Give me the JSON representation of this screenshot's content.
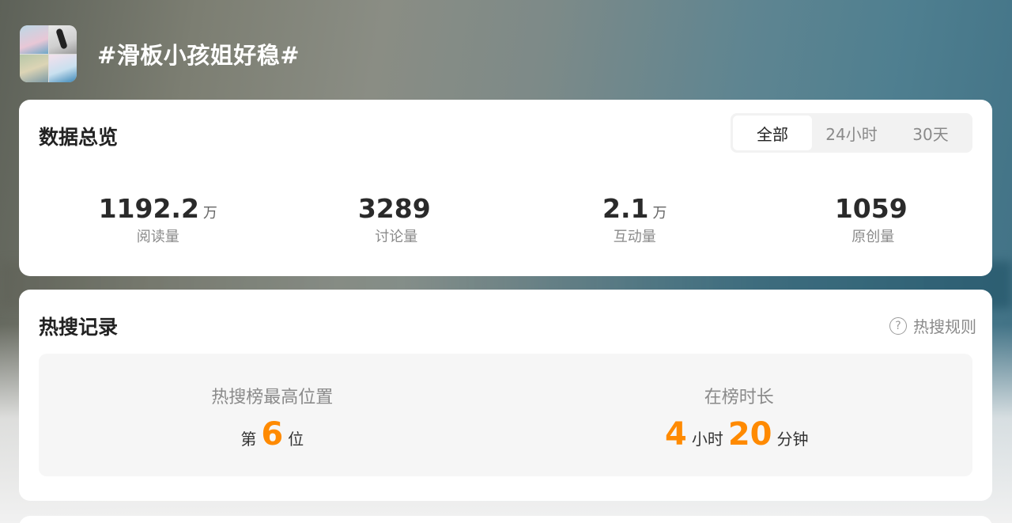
{
  "topic": {
    "title": "#滑板小孩姐好稳#",
    "thumbnail_icon": "topic-collage-image"
  },
  "overview": {
    "title": "数据总览",
    "tabs": [
      {
        "label": "全部",
        "active": true
      },
      {
        "label": "24小时",
        "active": false
      },
      {
        "label": "30天",
        "active": false
      }
    ],
    "stats": [
      {
        "value": "1192.2",
        "unit": "万",
        "label": "阅读量"
      },
      {
        "value": "3289",
        "unit": "",
        "label": "讨论量"
      },
      {
        "value": "2.1",
        "unit": "万",
        "label": "互动量"
      },
      {
        "value": "1059",
        "unit": "",
        "label": "原创量"
      }
    ]
  },
  "hot_search": {
    "title": "热搜记录",
    "rules_label": "热搜规则",
    "rules_icon": "question-circle-icon",
    "best_position": {
      "label": "热搜榜最高位置",
      "prefix": "第",
      "value": "6",
      "suffix": "位"
    },
    "duration": {
      "label": "在榜时长",
      "hours": "4",
      "hours_unit": "小时",
      "minutes": "20",
      "minutes_unit": "分钟"
    }
  },
  "colors": {
    "accent_orange": "#ff8a00",
    "text_dark": "#222222",
    "text_muted": "#8a8a8a"
  }
}
